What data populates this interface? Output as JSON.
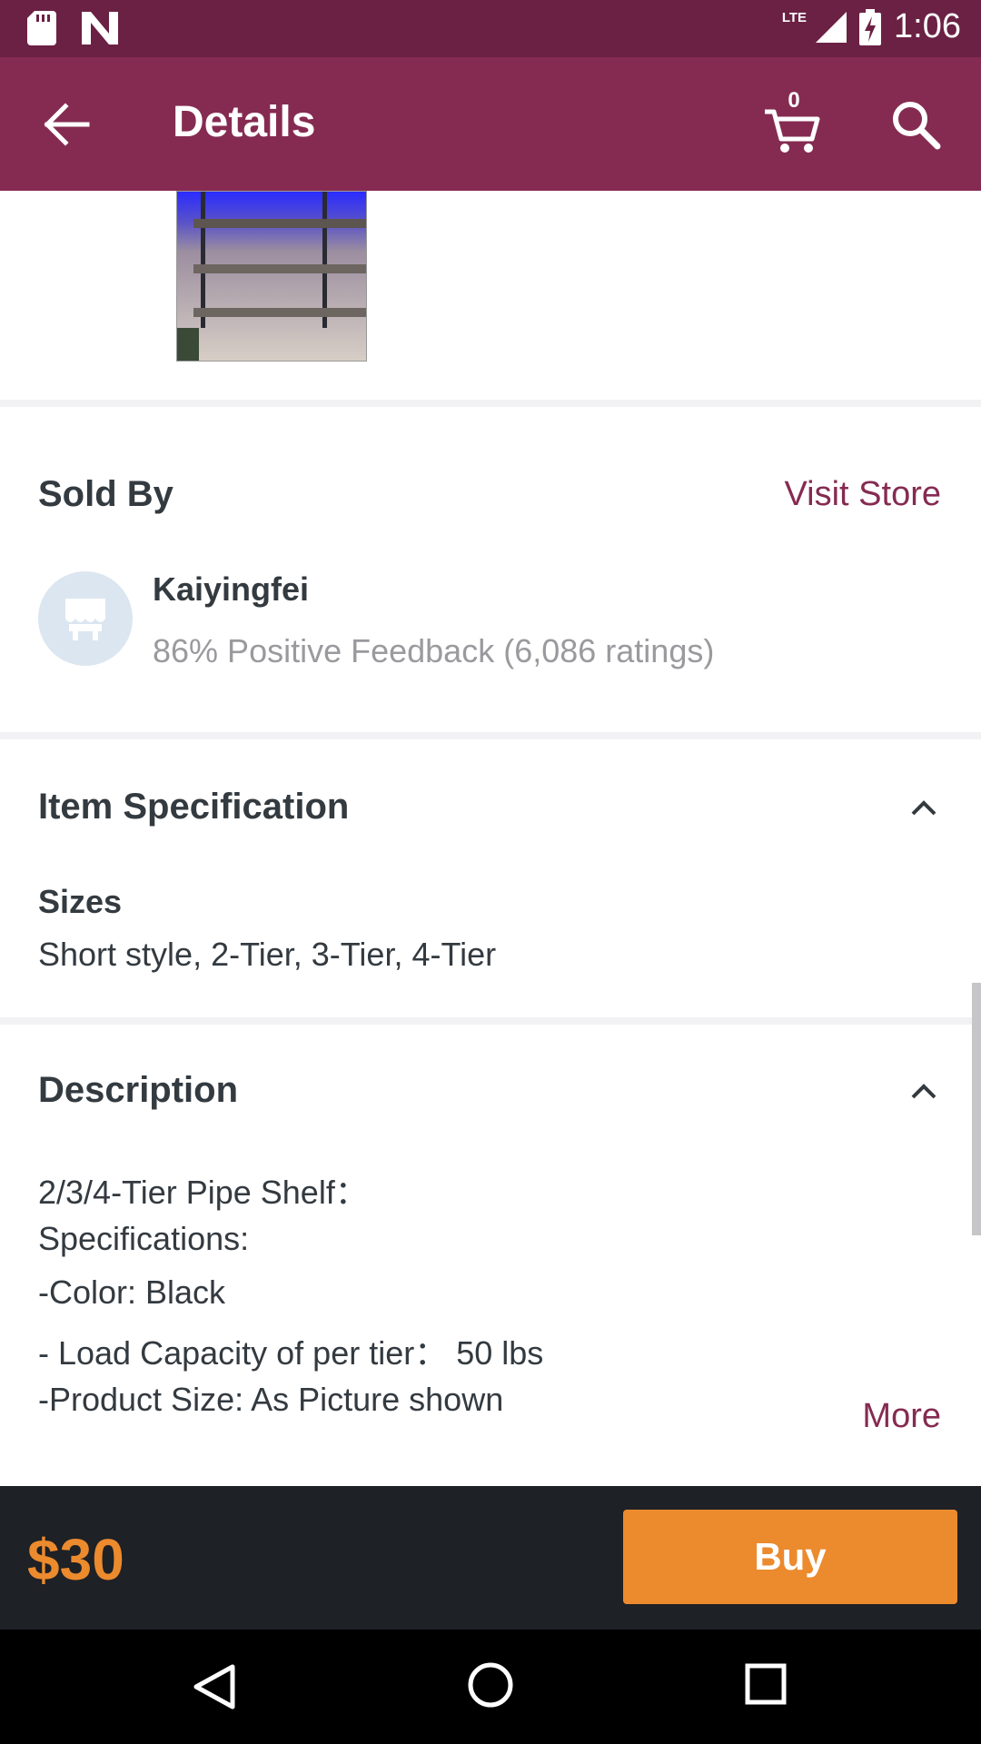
{
  "status_bar": {
    "time": "1:06",
    "network": "LTE"
  },
  "app_bar": {
    "title": "Details",
    "cart_count": "0",
    "icons": [
      "back-arrow-icon",
      "cart-icon",
      "search-icon"
    ]
  },
  "sold_by": {
    "title": "Sold By",
    "visit_store_label": "Visit Store",
    "seller_name": "Kaiyingfei",
    "feedback": "86% Positive Feedback (6,086 ratings)"
  },
  "item_specification": {
    "title": "Item Specification",
    "sizes_label": "Sizes",
    "sizes_value": "Short style, 2-Tier, 3-Tier, 4-Tier"
  },
  "description": {
    "title": "Description",
    "lines": [
      "2/3/4-Tier Pipe Shelf：",
      "Specifications:",
      "-Color: Black",
      "- Load Capacity of per tier： 50 lbs",
      "-Product Size: As Picture shown"
    ],
    "more_label": "More"
  },
  "bottom_bar": {
    "price": "$30",
    "buy_label": "Buy"
  },
  "colors": {
    "status_bar": "#6b2144",
    "app_bar": "#852b51",
    "accent_link": "#852b51",
    "price_orange": "#ec8a2e",
    "bottom_bar": "#1e2125"
  }
}
